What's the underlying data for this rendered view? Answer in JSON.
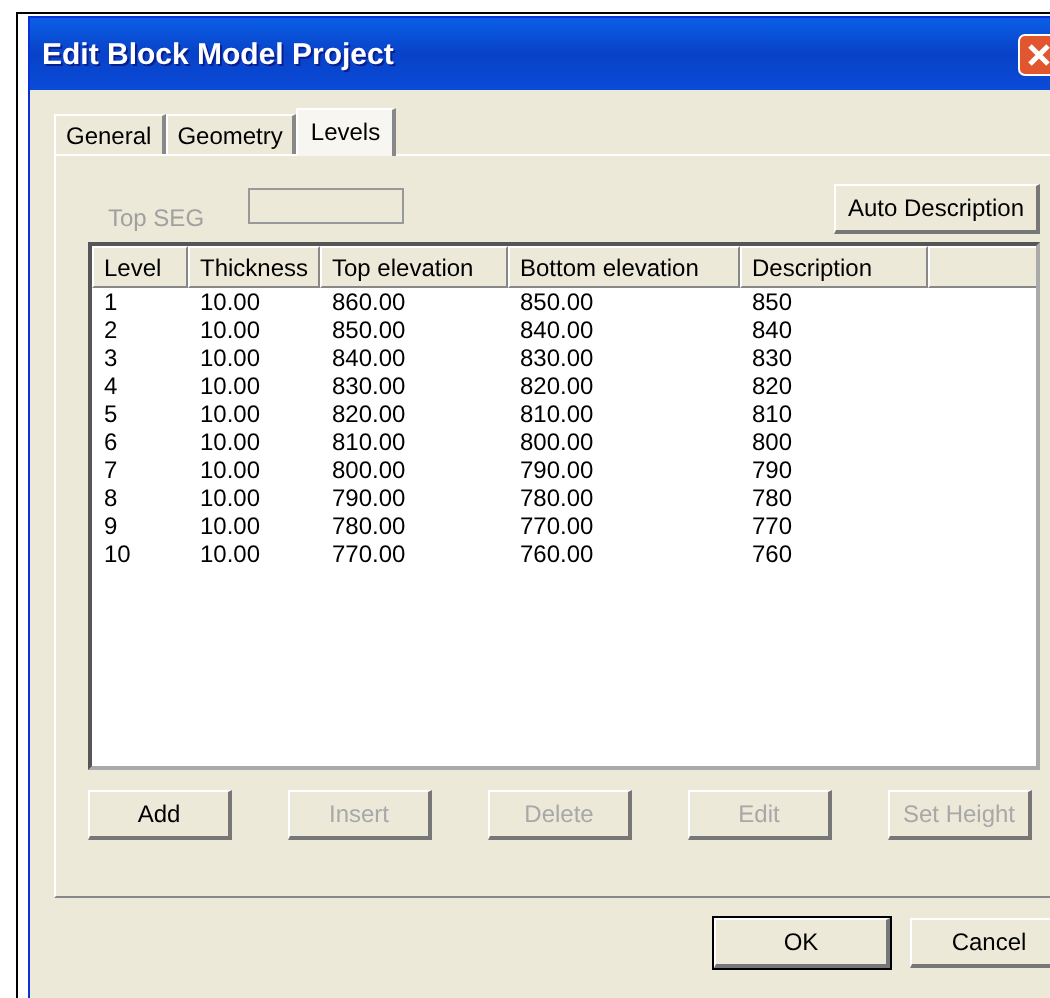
{
  "window": {
    "title": "Edit Block Model Project"
  },
  "tabs": [
    {
      "label": "General",
      "selected": false
    },
    {
      "label": "Geometry",
      "selected": false
    },
    {
      "label": "Levels",
      "selected": true
    }
  ],
  "top_seg": {
    "label": "Top SEG",
    "disabled": true
  },
  "auto_description": {
    "label": "Auto Description",
    "disabled": false
  },
  "table": {
    "columns": [
      "Level",
      "Thickness",
      "Top elevation",
      "Bottom elevation",
      "Description"
    ],
    "rows": [
      [
        "1",
        "10.00",
        "860.00",
        "850.00",
        "850"
      ],
      [
        "2",
        "10.00",
        "850.00",
        "840.00",
        "840"
      ],
      [
        "3",
        "10.00",
        "840.00",
        "830.00",
        "830"
      ],
      [
        "4",
        "10.00",
        "830.00",
        "820.00",
        "820"
      ],
      [
        "5",
        "10.00",
        "820.00",
        "810.00",
        "810"
      ],
      [
        "6",
        "10.00",
        "810.00",
        "800.00",
        "800"
      ],
      [
        "7",
        "10.00",
        "800.00",
        "790.00",
        "790"
      ],
      [
        "8",
        "10.00",
        "790.00",
        "780.00",
        "780"
      ],
      [
        "9",
        "10.00",
        "780.00",
        "770.00",
        "770"
      ],
      [
        "10",
        "10.00",
        "770.00",
        "760.00",
        "760"
      ]
    ]
  },
  "row_buttons": [
    {
      "label": "Add",
      "disabled": false
    },
    {
      "label": "Insert",
      "disabled": true
    },
    {
      "label": "Delete",
      "disabled": true
    },
    {
      "label": "Edit",
      "disabled": true
    },
    {
      "label": "Set Height",
      "disabled": true
    }
  ],
  "dialog_buttons": [
    {
      "label": "OK",
      "default": true
    },
    {
      "label": "Cancel",
      "default": false
    }
  ]
}
